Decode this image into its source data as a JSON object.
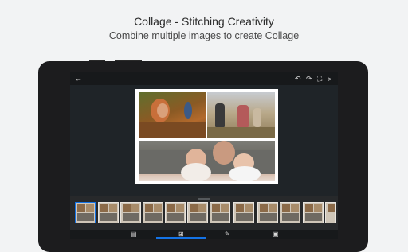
{
  "header": {
    "headline": "Collage - Stitching Creativity",
    "subline": "Combine multiple images to create Collage"
  },
  "toolbar": {
    "back_icon": "arrow-left-icon",
    "undo_icon": "undo-icon",
    "redo_icon": "redo-icon",
    "fullscreen_icon": "fullscreen-icon",
    "share_icon": "share-icon"
  },
  "collage": {
    "photos": [
      "autumn-leaves-child",
      "family-walk-field",
      "mother-and-babies"
    ]
  },
  "layouts": {
    "count": 12,
    "selected_index": 0
  },
  "bottom_bar": {
    "items": [
      "layout-icon",
      "grid-icon",
      "brush-icon",
      "photo-icon"
    ],
    "active_index": 1
  },
  "colors": {
    "accent": "#1473e6",
    "screen_bg": "#1f2326",
    "page_bg": "#f2f3f4"
  }
}
